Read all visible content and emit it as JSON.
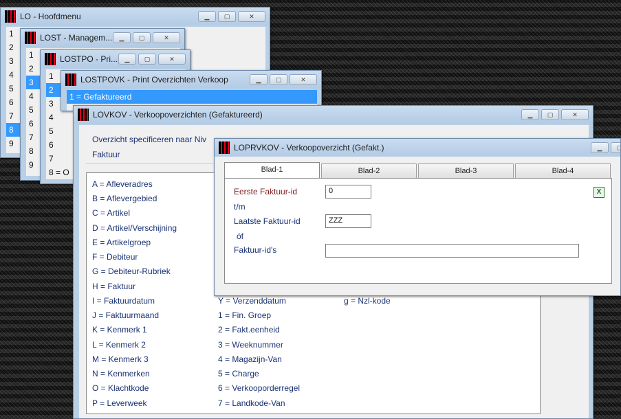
{
  "windows": {
    "lo": {
      "title": "LO - Hoofdmenu",
      "items": [
        "1",
        "2",
        "3",
        "4",
        "5",
        "6",
        "7",
        "8",
        "9"
      ],
      "selected": 7
    },
    "lost": {
      "title": "LOST - Managem...",
      "items": [
        "1",
        "2",
        "3",
        "4",
        "5",
        "6",
        "7",
        "8",
        "9"
      ],
      "selected": 2
    },
    "lostpo": {
      "title": "LOSTPO - Pri...",
      "items": [
        "1",
        "2",
        "3",
        "4",
        "5",
        "6",
        "7",
        "8 = O"
      ],
      "selected": 1
    },
    "lostpovk": {
      "title": "LOSTPOVK - Print Overzichten Verkoop",
      "items": [
        "1 = Gefaktureerd"
      ],
      "selected": 0
    },
    "lovkov": {
      "title": "LOVKOV - Verkoopoverzichten (Gefaktureerd)",
      "spec_label": "Overzicht specificeren naar Niv",
      "spec_value": "Faktuur",
      "col1": [
        "A = Afleveradres",
        "B = Aflevergebied",
        "C = Artikel",
        "D = Artikel/Verschijning",
        "E = Artikelgroep",
        "F = Debiteur",
        "G = Debiteur-Rubriek",
        "H = Faktuur",
        "I = Faktuurdatum",
        "J = Faktuurmaand",
        "K = Kenmerk 1",
        "L = Kenmerk 2",
        "M = Kenmerk 3",
        "N = Kenmerken",
        "O = Klachtkode",
        "P = Leverweek"
      ],
      "col2": [
        "Y = Verzenddatum",
        "1 = Fin. Groep",
        "2 = Fakt.eenheid",
        "3 = Weeknummer",
        "4 = Magazijn-Van",
        "5 = Charge",
        "6 = Verkooporderregel",
        "7 = Landkode-Van"
      ],
      "col3": [
        "g = Nzl-kode"
      ]
    },
    "loprvkov": {
      "title": "LOPRVKOV - Verkoopoverzicht (Gefakt.)",
      "tabs": [
        "Blad-1",
        "Blad-2",
        "Blad-3",
        "Blad-4"
      ],
      "active_tab": 0,
      "eerste_label": "Eerste  Faktuur-id",
      "eerste_value": "0",
      "tm_label": "t/m",
      "laatste_label": "Laatste Faktuur-id",
      "laatste_value": "ZZZ",
      "of_label": "óf",
      "faktuurids_label": "Faktuur-id's",
      "faktuurids_value": ""
    }
  },
  "titlebar_buttons": {
    "minimize": "▁",
    "maximize": "▢",
    "close": "✕"
  },
  "icons": {
    "app": "app-logo-icon",
    "excel": "excel-icon"
  },
  "colors": {
    "selection": "#3399ff",
    "label_blue": "#1a3273",
    "label_red": "#7a1f1f",
    "title_bg": "#b9cfe6"
  }
}
